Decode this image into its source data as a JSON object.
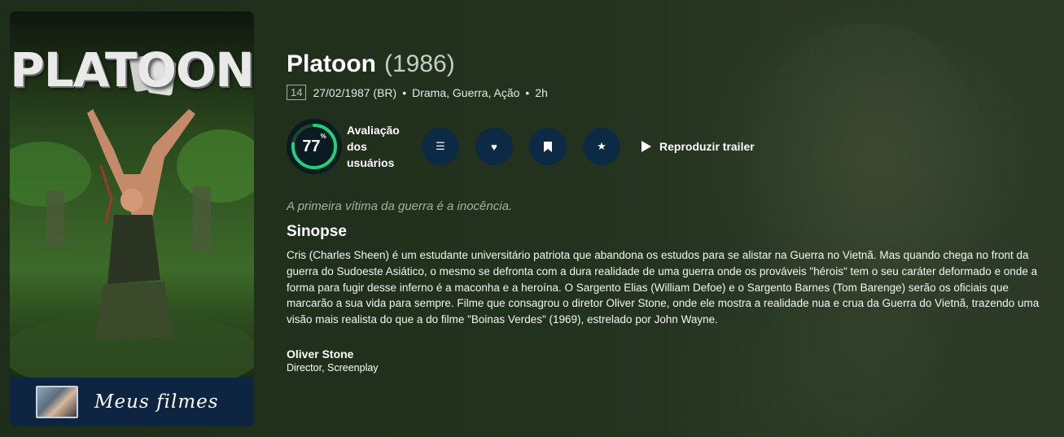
{
  "poster": {
    "title_text": "PLATOON",
    "footer_brand": "Meus filmes"
  },
  "movie": {
    "title": "Platoon",
    "year": "(1986)",
    "certification": "14",
    "release": "27/02/1987 (BR)",
    "genres": "Drama, Guerra, Ação",
    "runtime": "2h",
    "separator": "•"
  },
  "score": {
    "value": "77",
    "unit": "%",
    "percent": 77,
    "label": "Avaliação dos usuários",
    "ring_color": "#21d07a",
    "track_color": "#204529"
  },
  "actions": {
    "list_icon": "list-icon",
    "favorite_icon": "heart-icon",
    "watchlist_icon": "bookmark-icon",
    "rate_icon": "star-icon",
    "trailer_label": "Reproduzir trailer"
  },
  "tagline": "A primeira vítima da guerra é a inocência.",
  "overview": {
    "heading": "Sinopse",
    "text": "Cris (Charles Sheen) é um estudante universitário patriota que abandona os estudos para se alistar na Guerra no Vietnã. Mas quando chega no front da guerra do Sudoeste Asiático, o mesmo se defronta com a dura realidade de uma guerra onde os prováveis \"hérois\" tem o seu caráter deformado e onde a forma para fugir desse inferno é a maconha e a heroína. O Sargento Elias (William Defoe) e o Sargento Barnes (Tom Barenge) serão os oficiais que marcarão a sua vida para sempre. Filme que consagrou o diretor Oliver Stone, onde ele mostra a realidade nua e crua da Guerra do Vietnã, trazendo uma visão mais realista do que a do filme \"Boinas Verdes\" (1969), estrelado por John Wayne."
  },
  "crew": [
    {
      "name": "Oliver Stone",
      "job": "Director, Screenplay"
    }
  ],
  "colors": {
    "accent_button": "#0d2a44",
    "poster_footer": "#0d2540"
  }
}
